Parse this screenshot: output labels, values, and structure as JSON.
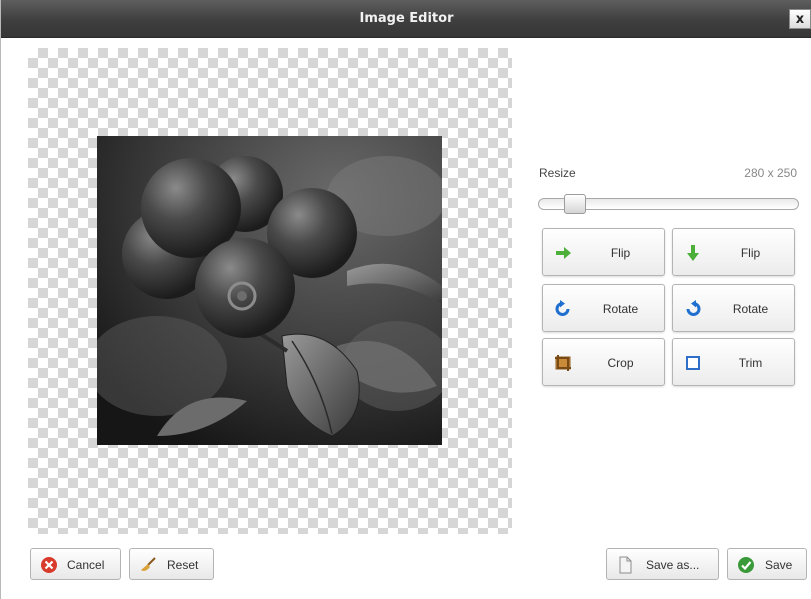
{
  "window": {
    "title": "Image Editor",
    "close_glyph": "x"
  },
  "editor": {
    "resize": {
      "label": "Resize",
      "value": "280 x 250",
      "slider_fraction": 0.1
    },
    "tools": [
      {
        "label": "Flip",
        "icon": "arrow-right-icon"
      },
      {
        "label": "Flip",
        "icon": "arrow-down-icon"
      },
      {
        "label": "Rotate",
        "icon": "rotate-left-icon"
      },
      {
        "label": "Rotate",
        "icon": "rotate-right-icon"
      },
      {
        "label": "Crop",
        "icon": "crop-icon"
      },
      {
        "label": "Trim",
        "icon": "trim-icon"
      }
    ]
  },
  "footer": {
    "cancel": "Cancel",
    "reset": "Reset",
    "save_as": "Save as...",
    "save": "Save"
  },
  "colors": {
    "arrow_green": "#4caf3a",
    "rotate_blue": "#1f6fd0",
    "cancel_red": "#d83b2b",
    "save_green": "#3a9a3a"
  }
}
